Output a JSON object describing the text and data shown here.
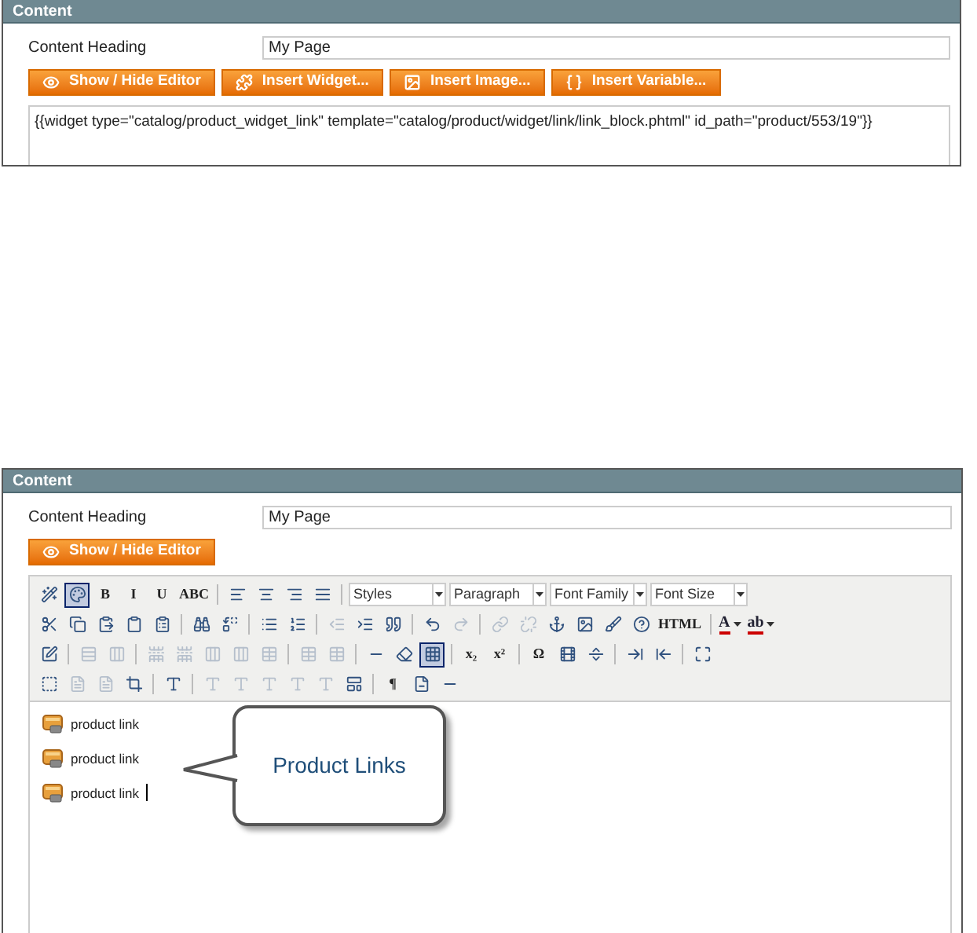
{
  "top_panel": {
    "title": "Content",
    "heading_label": "Content Heading",
    "heading_value": "My Page",
    "buttons": [
      {
        "kind": "eye",
        "label": "Show / Hide Editor"
      },
      {
        "kind": "widget",
        "label": "Insert Widget..."
      },
      {
        "kind": "image",
        "label": "Insert Image..."
      },
      {
        "kind": "variable",
        "label": "Insert Variable..."
      }
    ],
    "source": "{{widget type=\"catalog/product_widget_link\" template=\"catalog/product/widget/link/link_block.phtml\" id_path=\"product/553/19\"}}"
  },
  "bottom_panel": {
    "title": "Content",
    "heading_label": "Content Heading",
    "heading_value": "My Page",
    "buttons": [
      {
        "kind": "eye",
        "label": "Show / Hide Editor"
      }
    ],
    "toolbar": [
      [
        {
          "kind": "icon",
          "disabled": false,
          "selected": false
        },
        {
          "kind": "icon",
          "disabled": false,
          "selected": true
        },
        {
          "kind": "text",
          "label": "B",
          "disabled": false
        },
        {
          "kind": "text",
          "label": "I",
          "disabled": false
        },
        {
          "kind": "text",
          "label": "U",
          "disabled": false
        },
        {
          "kind": "text",
          "label": "ABC",
          "disabled": false
        },
        {
          "kind": "sep"
        },
        {
          "kind": "icon",
          "disabled": false,
          "selected": false
        },
        {
          "kind": "icon",
          "disabled": false,
          "selected": false
        },
        {
          "kind": "icon",
          "disabled": false,
          "selected": false
        },
        {
          "kind": "icon",
          "disabled": false,
          "selected": false
        },
        {
          "kind": "sep"
        },
        {
          "kind": "select",
          "label": "Styles"
        },
        {
          "kind": "select",
          "label": "Paragraph"
        },
        {
          "kind": "select",
          "label": "Font Family"
        },
        {
          "kind": "select",
          "label": "Font Size"
        }
      ],
      [
        {
          "kind": "icon",
          "disabled": false,
          "selected": false
        },
        {
          "kind": "icon",
          "disabled": false,
          "selected": false
        },
        {
          "kind": "icon",
          "disabled": false,
          "selected": false
        },
        {
          "kind": "icon",
          "disabled": false,
          "selected": false
        },
        {
          "kind": "icon",
          "disabled": false,
          "selected": false
        },
        {
          "kind": "sep"
        },
        {
          "kind": "icon",
          "disabled": false,
          "selected": false
        },
        {
          "kind": "icon",
          "disabled": false,
          "selected": false
        },
        {
          "kind": "sep"
        },
        {
          "kind": "icon",
          "disabled": false,
          "selected": false
        },
        {
          "kind": "icon",
          "disabled": false,
          "selected": false
        },
        {
          "kind": "sep"
        },
        {
          "kind": "icon",
          "disabled": true,
          "selected": false
        },
        {
          "kind": "icon",
          "disabled": false,
          "selected": false
        },
        {
          "kind": "icon",
          "disabled": false,
          "selected": false
        },
        {
          "kind": "sep"
        },
        {
          "kind": "icon",
          "disabled": false,
          "selected": false
        },
        {
          "kind": "icon",
          "disabled": true,
          "selected": false
        },
        {
          "kind": "sep"
        },
        {
          "kind": "icon",
          "disabled": true,
          "selected": false
        },
        {
          "kind": "icon",
          "disabled": true,
          "selected": false
        },
        {
          "kind": "icon",
          "disabled": false,
          "selected": false
        },
        {
          "kind": "icon",
          "disabled": false,
          "selected": false
        },
        {
          "kind": "icon",
          "disabled": false,
          "selected": false
        },
        {
          "kind": "icon",
          "disabled": false,
          "selected": false
        },
        {
          "kind": "text",
          "label": "HTML",
          "disabled": false
        },
        {
          "kind": "sep"
        },
        {
          "kind": "color",
          "label": "A"
        },
        {
          "kind": "color",
          "label": "ab"
        }
      ],
      [
        {
          "kind": "icon",
          "disabled": false,
          "selected": false
        },
        {
          "kind": "sep"
        },
        {
          "kind": "icon",
          "disabled": true,
          "selected": false
        },
        {
          "kind": "icon",
          "disabled": true,
          "selected": false
        },
        {
          "kind": "sep"
        },
        {
          "kind": "icon",
          "disabled": true,
          "selected": false
        },
        {
          "kind": "icon",
          "disabled": true,
          "selected": false
        },
        {
          "kind": "icon",
          "disabled": true,
          "selected": false
        },
        {
          "kind": "icon",
          "disabled": true,
          "selected": false
        },
        {
          "kind": "icon",
          "disabled": true,
          "selected": false
        },
        {
          "kind": "sep"
        },
        {
          "kind": "icon",
          "disabled": true,
          "selected": false
        },
        {
          "kind": "icon",
          "disabled": true,
          "selected": false
        },
        {
          "kind": "sep"
        },
        {
          "kind": "icon",
          "disabled": false,
          "selected": false
        },
        {
          "kind": "icon",
          "disabled": false,
          "selected": false
        },
        {
          "kind": "icon",
          "disabled": false,
          "selected": true
        },
        {
          "kind": "sep"
        },
        {
          "kind": "text",
          "label": "x₂",
          "disabled": false
        },
        {
          "kind": "text",
          "label": "x²",
          "disabled": false
        },
        {
          "kind": "sep"
        },
        {
          "kind": "text",
          "label": "Ω",
          "disabled": false
        },
        {
          "kind": "icon",
          "disabled": false,
          "selected": false
        },
        {
          "kind": "icon",
          "disabled": false,
          "selected": false
        },
        {
          "kind": "sep"
        },
        {
          "kind": "icon",
          "disabled": false,
          "selected": false
        },
        {
          "kind": "icon",
          "disabled": false,
          "selected": false
        },
        {
          "kind": "sep"
        },
        {
          "kind": "icon",
          "disabled": false,
          "selected": false
        }
      ],
      [
        {
          "kind": "icon",
          "disabled": false,
          "selected": false
        },
        {
          "kind": "icon",
          "disabled": true,
          "selected": false
        },
        {
          "kind": "icon",
          "disabled": true,
          "selected": false
        },
        {
          "kind": "icon",
          "disabled": false,
          "selected": false
        },
        {
          "kind": "sep"
        },
        {
          "kind": "icon",
          "disabled": false,
          "selected": false
        },
        {
          "kind": "sep"
        },
        {
          "kind": "icon",
          "disabled": true,
          "selected": false
        },
        {
          "kind": "icon",
          "disabled": true,
          "selected": false
        },
        {
          "kind": "icon",
          "disabled": true,
          "selected": false
        },
        {
          "kind": "icon",
          "disabled": true,
          "selected": false
        },
        {
          "kind": "icon",
          "disabled": true,
          "selected": false
        },
        {
          "kind": "icon",
          "disabled": false,
          "selected": false
        },
        {
          "kind": "sep"
        },
        {
          "kind": "text",
          "label": "¶",
          "disabled": false
        },
        {
          "kind": "icon",
          "disabled": false,
          "selected": false
        },
        {
          "kind": "icon",
          "disabled": false,
          "selected": false
        }
      ]
    ],
    "links": [
      "product link",
      "product link",
      "product link"
    ],
    "callout": "Product Links"
  }
}
